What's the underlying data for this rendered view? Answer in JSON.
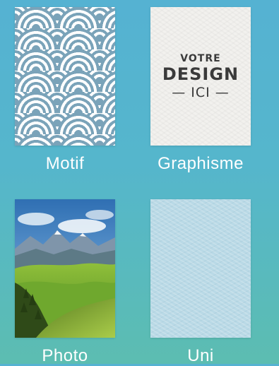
{
  "options": [
    {
      "label": "Motif",
      "name": "motif"
    },
    {
      "label": "Graphisme",
      "name": "graphisme",
      "preview_text": [
        "VOTRE",
        "DESIGN",
        "— ICI —"
      ]
    },
    {
      "label": "Photo",
      "name": "photo"
    },
    {
      "label": "Uni",
      "name": "uni"
    }
  ],
  "colors": {
    "background_top": "#55b2d2",
    "background_bottom": "#5cbdb1",
    "motif_blue": "#7aa3b9",
    "uni_blue": "#b9d9e6",
    "label_text": "#ffffff"
  }
}
